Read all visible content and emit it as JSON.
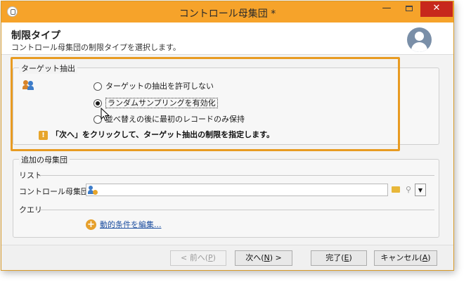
{
  "window": {
    "title": "コントロール母集団 *",
    "minimize_glyph": "—",
    "close_glyph": "✕"
  },
  "header": {
    "title": "制限タイプ",
    "subtitle": "コントロール母集団の制限タイプを選択します。"
  },
  "target_extraction": {
    "label": "ターゲット抽出",
    "options": [
      {
        "label": "ターゲットの抽出を許可しない",
        "selected": false
      },
      {
        "label": "ランダムサンプリングを有効化",
        "selected": true
      },
      {
        "label": "並べ替えの後に最初のレコードのみ保持",
        "selected": false
      }
    ],
    "warning_glyph": "!",
    "warning": "「次へ」をクリックして、ターゲット抽出の制限を指定します。"
  },
  "additional_population": {
    "label": "追加の母集団",
    "list_label": "リスト",
    "control_population_label": "コントロール母集団:",
    "control_population_value": "",
    "query_label": "クエリ",
    "edit_link_label": "動的条件を編集..."
  },
  "buttons": {
    "back_prefix": "< 前へ(",
    "back_key": "P",
    "back_suffix": ")",
    "next_prefix": "次へ(",
    "next_key": "N",
    "next_suffix": ") >",
    "finish_prefix": "完了(",
    "finish_key": "E",
    "finish_suffix": ")",
    "cancel_prefix": "キャンセル(",
    "cancel_key": "A",
    "cancel_suffix": ")"
  },
  "colors": {
    "titlebar": "#f6a32a",
    "highlight": "#e89b22",
    "link": "#1c4fa0"
  }
}
